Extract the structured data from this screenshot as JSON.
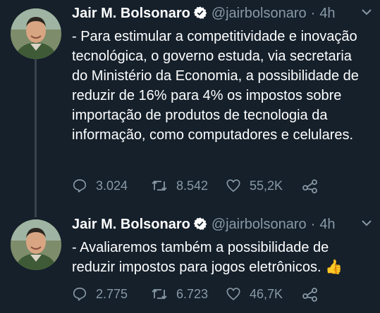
{
  "colors": {
    "background": "#15202b",
    "text": "#ffffff",
    "muted": "#8899a6",
    "verified": "#ffffff",
    "thread_line": "#38444d"
  },
  "tweets": [
    {
      "author_name": "Jair M. Bolsonaro",
      "handle": "@jairbolsonaro",
      "separator": "·",
      "time": "4h",
      "text": "- Para estimular a competitividade e inovação tecnológica, o governo estuda, via secretaria do Ministério da Economia, a possibilidade de reduzir de 16% para 4% os impostos sobre importação de produtos de tecnologia da informação, como computadores e celulares.",
      "replies": "3.024",
      "retweets": "8.542",
      "likes": "55,2K"
    },
    {
      "author_name": "Jair M. Bolsonaro",
      "handle": "@jairbolsonaro",
      "separator": "·",
      "time": "4h",
      "text": "-  Avaliaremos também a possibilidade de reduzir impostos para jogos eletrônicos.",
      "emoji": "👍",
      "replies": "2.775",
      "retweets": "6.723",
      "likes": "46,7K"
    }
  ]
}
